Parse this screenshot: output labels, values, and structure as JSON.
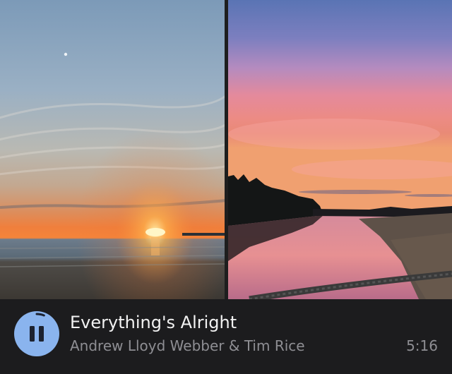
{
  "photos": [
    {
      "icon": "sunset-beach-photo"
    },
    {
      "icon": "sunset-river-photo"
    }
  ],
  "player": {
    "state": "playing",
    "progress": 0.06,
    "control_icon": "pause-icon",
    "accent_color": "#8ab4ee",
    "track_title": "Everything's Alright",
    "artist": "Andrew Lloyd Webber & Tim Rice",
    "duration": "5:16"
  }
}
